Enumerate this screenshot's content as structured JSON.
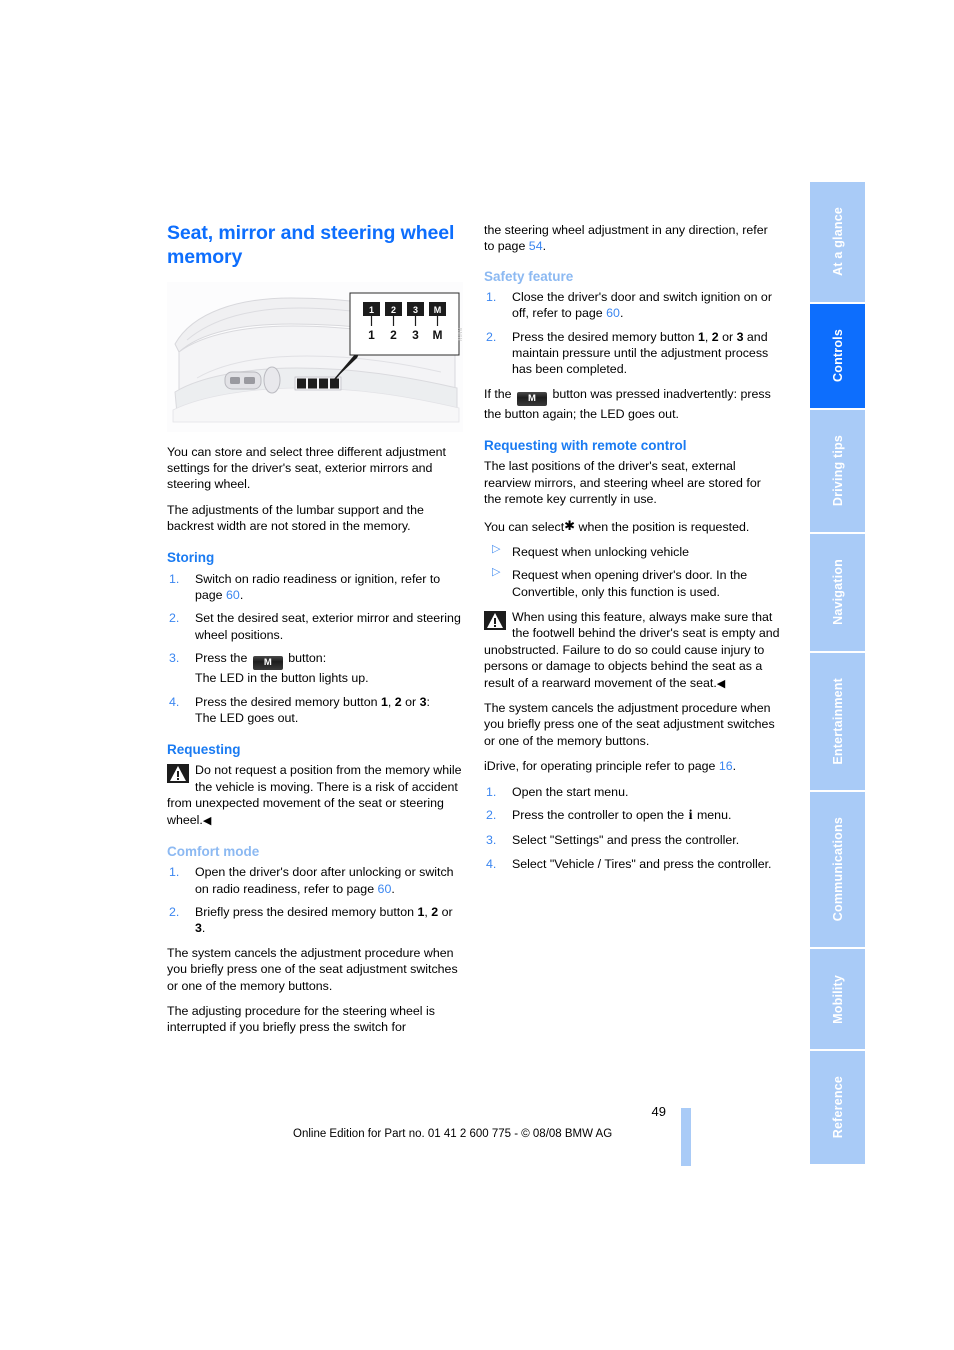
{
  "document": {
    "page_number": "49",
    "footer_text": "Online Edition for Part no. 01 41 2 600 775 - © 08/08 BMW AG"
  },
  "sidebar": {
    "tabs": [
      {
        "label": "At a glance",
        "active": false
      },
      {
        "label": "Controls",
        "active": true
      },
      {
        "label": "Driving tips",
        "active": false
      },
      {
        "label": "Navigation",
        "active": false
      },
      {
        "label": "Entertainment",
        "active": false
      },
      {
        "label": "Communications",
        "active": false
      },
      {
        "label": "Mobility",
        "active": false
      },
      {
        "label": "Reference",
        "active": false
      }
    ]
  },
  "colors": {
    "heading_blue": "#0d6efd",
    "subheading_blue": "#1a7bf2",
    "subheading_light_blue": "#8cb9f2",
    "tab_inactive": "#a9cbf7",
    "tab_active": "#0d6efd",
    "link_blue": "#3b86f0"
  },
  "left_column": {
    "title": "Seat, mirror and steering wheel memory",
    "figure": {
      "caption_labels": [
        "1",
        "2",
        "3",
        "M"
      ],
      "alt": "Driver seat side panel showing memory buttons 1, 2, 3 and M"
    },
    "intro_paragraphs": [
      "You can store and select three different adjustment settings for the driver's seat, exterior mirrors and steering wheel.",
      "The adjustments of the lumbar support and the backrest width are not stored in the memory."
    ],
    "storing": {
      "heading": "Storing",
      "steps": [
        {
          "pre": "Switch on radio readiness or ignition, refer to page ",
          "ref": "60",
          "post": "."
        },
        {
          "pre": "Set the desired seat, exterior mirror and steering wheel positions.",
          "ref": "",
          "post": ""
        },
        {
          "pre": "Press the ",
          "button": "M",
          "post": " button:",
          "second_line": "The LED in the button lights up."
        },
        {
          "pre": "Press the desired memory button ",
          "bold1": "1",
          "mid1": ", ",
          "bold2": "2",
          "mid2": " or ",
          "bold3": "3",
          "post": ":",
          "second_line": "The LED goes out."
        }
      ]
    },
    "requesting": {
      "heading": "Requesting",
      "warning": "Do not request a position from the memory while the vehicle is moving. There is a risk of accident from unexpected movement of the seat or steering wheel."
    },
    "comfort_mode": {
      "heading": "Comfort mode",
      "steps": [
        {
          "pre": "Open the driver's door after unlocking or switch on radio readiness, refer to page ",
          "ref": "60",
          "post": "."
        },
        {
          "pre": "Briefly press the desired memory button ",
          "bold1": "1",
          "mid1": ", ",
          "bold2": "2",
          "mid2": " or ",
          "bold3": "3",
          "post": "."
        }
      ],
      "paragraphs": [
        "The system cancels the adjustment procedure when you briefly press one of the seat adjustment switches or one of the memory buttons.",
        "The adjusting procedure for the steering wheel is interrupted if you briefly press the switch for"
      ]
    }
  },
  "right_column": {
    "continuation": {
      "pre": "the steering wheel adjustment in any direction, refer to page ",
      "ref": "54",
      "post": "."
    },
    "safety_feature": {
      "heading": "Safety feature",
      "steps": [
        {
          "pre": "Close the driver's door and switch ignition on or off, refer to page ",
          "ref": "60",
          "post": "."
        },
        {
          "pre": "Press the desired memory button ",
          "bold1": "1",
          "mid1": ", ",
          "bold2": "2",
          "mid2": " or ",
          "bold3": "3",
          "post": " and maintain pressure until the adjustment process has been completed."
        }
      ],
      "note_pre": "If the ",
      "note_button": "M",
      "note_post": " button was pressed inadvertently: press the button again; the LED goes out."
    },
    "requesting_remote": {
      "heading": "Requesting with remote control",
      "paragraph1": "The last positions of the driver's seat, external rearview mirrors, and steering wheel are stored for the remote key currently in use.",
      "paragraph2_pre": "You can select",
      "paragraph2_post": " when the position is requested.",
      "bullets": [
        "Request when unlocking vehicle",
        "Request when opening driver's door. In the Convertible, only this function is used."
      ],
      "warning": "When using this feature, always make sure that the footwell behind the driver's seat is empty and unobstructed. Failure to do so could cause injury to persons or damage to objects behind the seat as a result of a rearward movement of the seat.",
      "paragraph3": "The system cancels the adjustment procedure when you briefly press one of the seat adjustment switches or one of the memory buttons.",
      "idrive_pre": "iDrive, for operating principle refer to page ",
      "idrive_ref": "16",
      "idrive_post": ".",
      "steps": [
        {
          "text": "Open the start menu."
        },
        {
          "pre": "Press the controller to open the ",
          "icon": "i",
          "post": " menu."
        },
        {
          "text": "Select \"Settings\" and press the controller."
        },
        {
          "text": "Select \"Vehicle / Tires\" and press the controller."
        }
      ]
    }
  }
}
